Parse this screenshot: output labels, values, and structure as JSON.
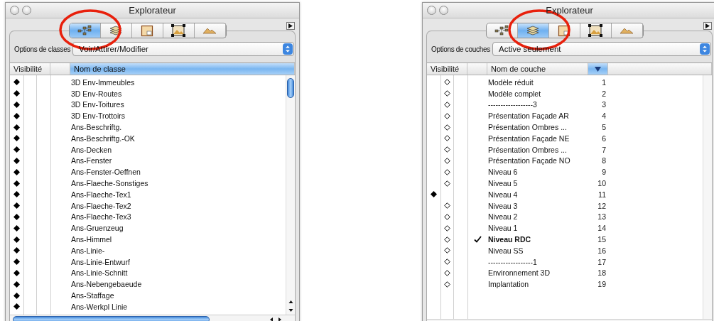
{
  "windows": [
    {
      "title": "Explorateur",
      "scrollable": true,
      "annotation": {
        "kind": "ellipse"
      },
      "tabs": [
        {
          "kind": "classes",
          "selected": true
        },
        {
          "kind": "layers",
          "selected": false
        },
        {
          "kind": "sheets",
          "selected": false
        },
        {
          "kind": "viewports",
          "selected": false
        },
        {
          "kind": "terrain",
          "selected": false
        }
      ],
      "options": {
        "label": "Options de classes",
        "value": "Voir/Attirer/Modifier"
      },
      "columns": [
        {
          "kind": "visibility",
          "label": "Visibilité",
          "selected": false
        },
        {
          "kind": "name",
          "label": "Nom de classe",
          "selected": true
        }
      ],
      "rows": [
        {
          "name": "3D Env-Immeubles",
          "visible": true
        },
        {
          "name": "3D Env-Routes",
          "visible": true
        },
        {
          "name": "3D Env-Toitures",
          "visible": true
        },
        {
          "name": "3D Env-Trottoirs",
          "visible": true
        },
        {
          "name": "Ans-Beschriftg.",
          "visible": true
        },
        {
          "name": "Ans-Beschriftg.-OK",
          "visible": true
        },
        {
          "name": "Ans-Decken",
          "visible": true
        },
        {
          "name": "Ans-Fenster",
          "visible": true
        },
        {
          "name": "Ans-Fenster-Oeffnen",
          "visible": true
        },
        {
          "name": "Ans-Flaeche-Sonstiges",
          "visible": true
        },
        {
          "name": "Ans-Flaeche-Tex1",
          "visible": true
        },
        {
          "name": "Ans-Flaeche-Tex2",
          "visible": true
        },
        {
          "name": "Ans-Flaeche-Tex3",
          "visible": true
        },
        {
          "name": "Ans-Gruenzeug",
          "visible": true
        },
        {
          "name": "Ans-Himmel",
          "visible": true
        },
        {
          "name": "Ans-Linie-",
          "visible": true
        },
        {
          "name": "Ans-Linie-Entwurf",
          "visible": true
        },
        {
          "name": "Ans-Linie-Schnitt",
          "visible": true
        },
        {
          "name": "Ans-Nebengebaeude",
          "visible": true
        },
        {
          "name": "Ans-Staffage",
          "visible": true
        },
        {
          "name": "Ans-Werkpl Linie",
          "visible": true
        }
      ]
    },
    {
      "title": "Explorateur",
      "scrollable": false,
      "annotation": {
        "kind": "ellipse"
      },
      "tabs": [
        {
          "kind": "classes",
          "selected": false
        },
        {
          "kind": "layers",
          "selected": true
        },
        {
          "kind": "sheets",
          "selected": false
        },
        {
          "kind": "viewports",
          "selected": false
        },
        {
          "kind": "terrain",
          "selected": false
        }
      ],
      "options": {
        "label": "Options de couches",
        "value": "Active seulement"
      },
      "columns": [
        {
          "kind": "visibility",
          "label": "Visibilité",
          "selected": false
        },
        {
          "kind": "name",
          "label": "Nom de couche",
          "selected": false
        },
        {
          "kind": "sort",
          "selected": true
        }
      ],
      "rows": [
        {
          "name": "Modèle réduit",
          "number": "1",
          "visible": false,
          "active": false
        },
        {
          "name": "Modèle complet",
          "number": "2",
          "visible": false,
          "active": false
        },
        {
          "name": "------------------3",
          "number": "3",
          "visible": false,
          "active": false
        },
        {
          "name": "Présentation Façade AR",
          "number": "4",
          "visible": false,
          "active": false
        },
        {
          "name": "Présentation Ombres ...",
          "number": "5",
          "visible": false,
          "active": false
        },
        {
          "name": "Présentation Façade NE",
          "number": "6",
          "visible": false,
          "active": false
        },
        {
          "name": "Présentation Ombres ...",
          "number": "7",
          "visible": false,
          "active": false
        },
        {
          "name": "Présentation Façade NO",
          "number": "8",
          "visible": false,
          "active": false
        },
        {
          "name": "Niveau 6",
          "number": "9",
          "visible": false,
          "active": false
        },
        {
          "name": "Niveau 5",
          "number": "10",
          "visible": false,
          "active": false
        },
        {
          "name": "Niveau 4",
          "number": "11",
          "visible": true,
          "active": false
        },
        {
          "name": "Niveau 3",
          "number": "12",
          "visible": false,
          "active": false
        },
        {
          "name": "Niveau 2",
          "number": "13",
          "visible": false,
          "active": false
        },
        {
          "name": "Niveau 1",
          "number": "14",
          "visible": false,
          "active": false
        },
        {
          "name": "Niveau RDC",
          "number": "15",
          "visible": false,
          "active": true
        },
        {
          "name": "Niveau SS",
          "number": "16",
          "visible": false,
          "active": false
        },
        {
          "name": "------------------1",
          "number": "17",
          "visible": false,
          "active": false
        },
        {
          "name": "Environnement 3D",
          "number": "18",
          "visible": false,
          "active": false
        },
        {
          "name": "Implantation",
          "number": "19",
          "visible": false,
          "active": false
        }
      ]
    }
  ]
}
